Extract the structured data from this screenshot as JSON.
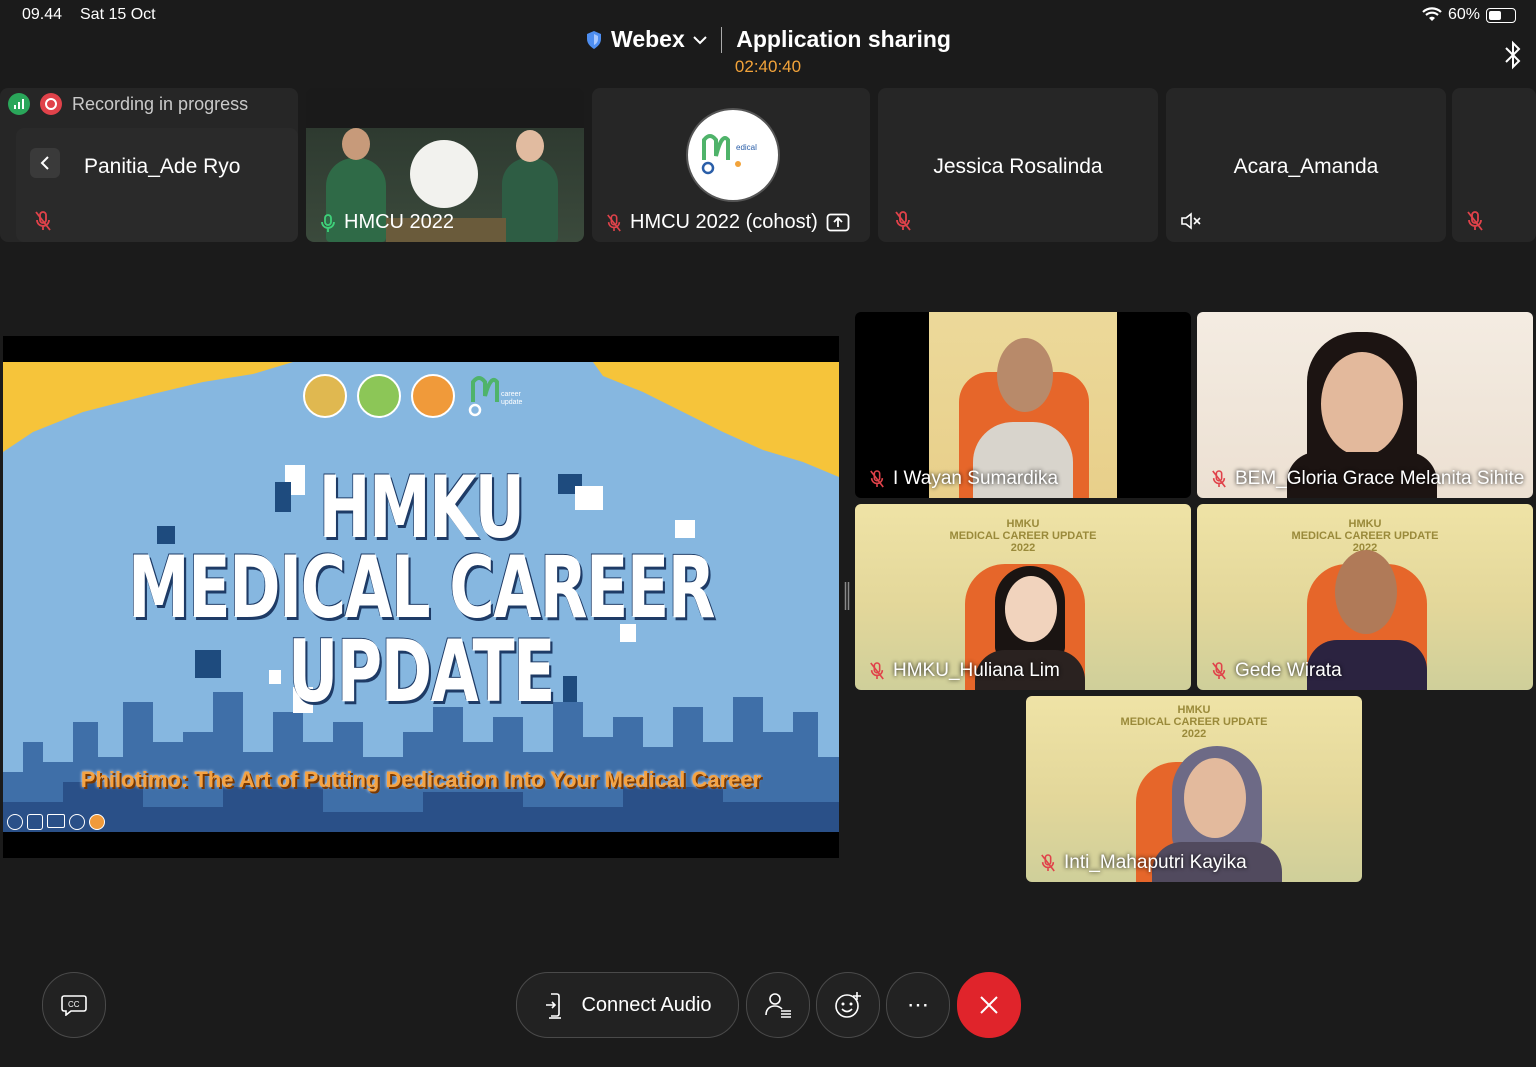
{
  "status_bar": {
    "time": "09.44",
    "date": "Sat 15 Oct",
    "battery": "60%",
    "battery_level": 0.6
  },
  "header": {
    "app_name": "Webex",
    "title": "Application sharing",
    "timer": "02:40:40"
  },
  "recording": {
    "label": "Recording in progress"
  },
  "strip": {
    "tiles": [
      {
        "name": "Panitia_Ade Ryo",
        "mic": "muted"
      },
      {
        "name": "HMCU 2022",
        "mic": "active"
      },
      {
        "name": "HMCU 2022 (cohost)",
        "mic": "muted"
      },
      {
        "name": "Jessica Rosalinda",
        "mic": "muted"
      },
      {
        "name": "Acara_Amanda",
        "mic": "speaker-muted"
      },
      {
        "name": "",
        "mic": "muted"
      }
    ]
  },
  "share": {
    "title_lines": [
      "HMKU",
      "MEDICAL CAREER",
      "UPDATE"
    ],
    "subtitle": "Philotimo: The Art of Putting Dedication Into Your Medical Career",
    "logo_text": [
      "edical",
      "career",
      "update"
    ]
  },
  "videos": [
    {
      "name": "I Wayan Sumardika"
    },
    {
      "name": "BEM_Gloria Grace Melanita Sihite"
    },
    {
      "name": "HMKU_Huliana Lim"
    },
    {
      "name": "Gede Wirata"
    },
    {
      "name": "Inti_Mahaputri Kayika"
    }
  ],
  "poster": {
    "line1": "HMKU",
    "line2": "MEDICAL CAREER UPDATE",
    "line3": "2022"
  },
  "controls": {
    "connect_audio": "Connect Audio",
    "cc": "CC",
    "more": "⋯"
  },
  "colors": {
    "accent_orange": "#f2a33a",
    "end_red": "#e0242b",
    "muted_red": "#e0424a"
  }
}
